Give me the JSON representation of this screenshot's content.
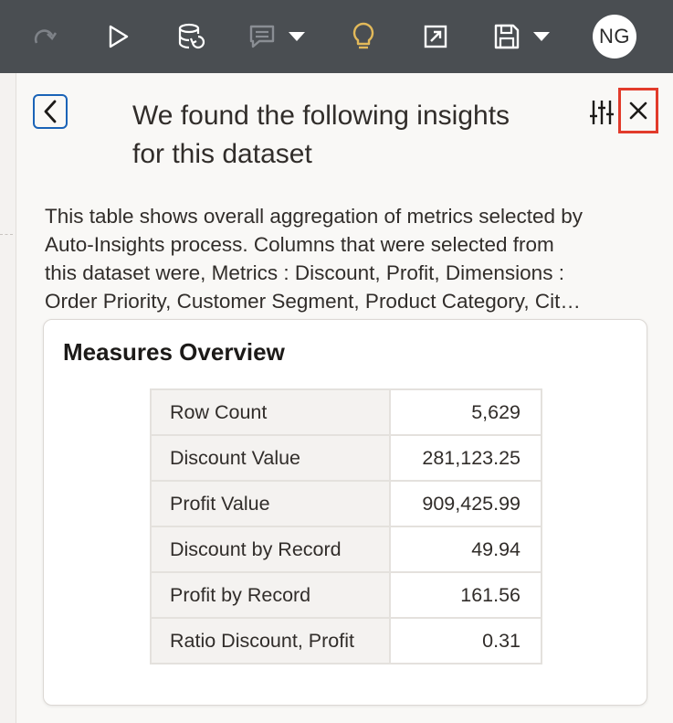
{
  "toolbar": {
    "icons": [
      "redo-icon",
      "run-icon",
      "dataset-refresh-icon",
      "comment-icon",
      "insights-lightbulb-icon",
      "present-icon",
      "save-icon"
    ],
    "accent_color": "#e2b95a",
    "user_initials": "NG"
  },
  "panel": {
    "title": "We found the following insights for this dataset",
    "description": "This table shows overall aggregation of metrics selected by\nAuto-Insights process. Columns that were selected from\nthis dataset were, Metrics : Discount, Profit, Dimensions :\nOrder Priority, Customer Segment, Product Category, Cit…",
    "close_highlight_color": "#e23b2b"
  },
  "card": {
    "title": "Measures Overview",
    "rows": [
      {
        "label": "Row Count",
        "value": "5,629"
      },
      {
        "label": "Discount Value",
        "value": "281,123.25"
      },
      {
        "label": "Profit Value",
        "value": "909,425.99"
      },
      {
        "label": "Discount by Record",
        "value": "49.94"
      },
      {
        "label": "Profit by Record",
        "value": "161.56"
      },
      {
        "label": "Ratio Discount, Profit",
        "value": "0.31"
      }
    ]
  }
}
